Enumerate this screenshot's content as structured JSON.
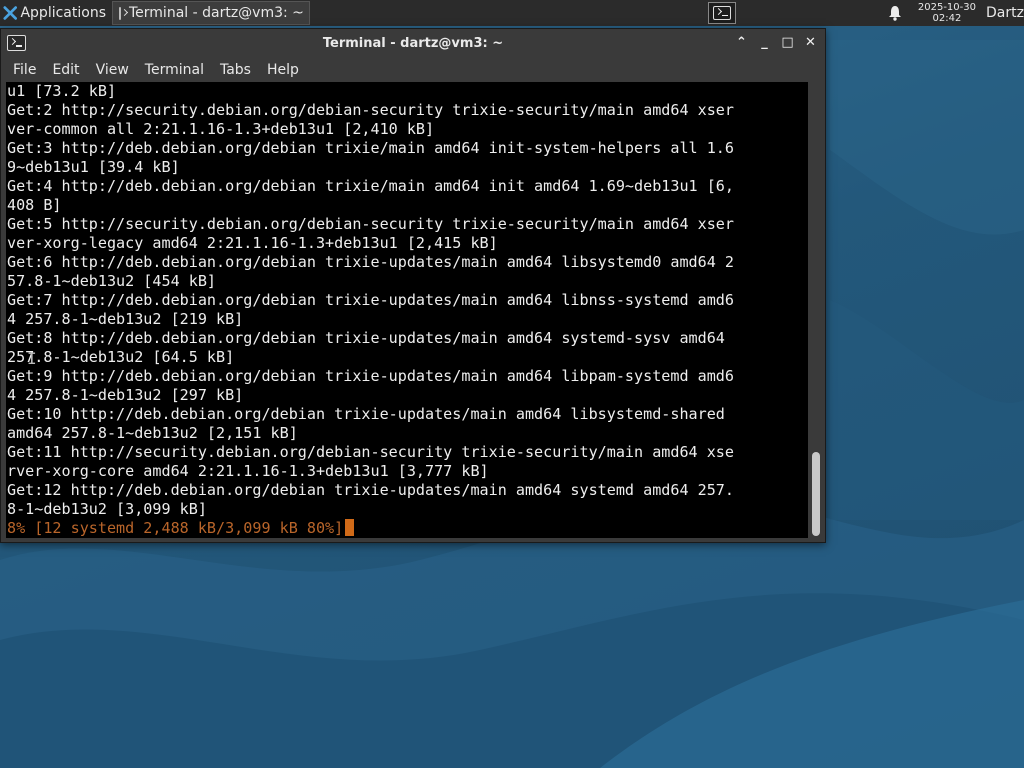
{
  "panel": {
    "apps_label": "Applications",
    "task_label": "Terminal - dartz@vm3: ~",
    "clock_date": "2025-10-30",
    "clock_time": "02:42",
    "user": "Dartz",
    "icons": {
      "apps": "xfce-logo-icon",
      "task": "terminal-icon",
      "workspace": "terminal-icon",
      "notifications": "bell-icon"
    }
  },
  "window": {
    "title": "Terminal - dartz@vm3: ~",
    "controls": [
      "shade",
      "minimize",
      "maximize",
      "close"
    ],
    "control_glyphs": {
      "shade": "⌃",
      "minimize": "_",
      "maximize": "□",
      "close": "✕"
    }
  },
  "menu": [
    "File",
    "Edit",
    "View",
    "Terminal",
    "Tabs",
    "Help"
  ],
  "terminal": {
    "lines": [
      "u1 [73.2 kB]",
      "Get:2 http://security.debian.org/debian-security trixie-security/main amd64 xser",
      "ver-common all 2:21.1.16-1.3+deb13u1 [2,410 kB]",
      "Get:3 http://deb.debian.org/debian trixie/main amd64 init-system-helpers all 1.6",
      "9~deb13u1 [39.4 kB]",
      "Get:4 http://deb.debian.org/debian trixie/main amd64 init amd64 1.69~deb13u1 [6,",
      "408 B]",
      "Get:5 http://security.debian.org/debian-security trixie-security/main amd64 xser",
      "ver-xorg-legacy amd64 2:21.1.16-1.3+deb13u1 [2,415 kB]",
      "Get:6 http://deb.debian.org/debian trixie-updates/main amd64 libsystemd0 amd64 2",
      "57.8-1~deb13u2 [454 kB]",
      "Get:7 http://deb.debian.org/debian trixie-updates/main amd64 libnss-systemd amd6",
      "4 257.8-1~deb13u2 [219 kB]",
      "Get:8 http://deb.debian.org/debian trixie-updates/main amd64 systemd-sysv amd64",
      "257.8-1~deb13u2 [64.5 kB]",
      "Get:9 http://deb.debian.org/debian trixie-updates/main amd64 libpam-systemd amd6",
      "4 257.8-1~deb13u2 [297 kB]",
      "Get:10 http://deb.debian.org/debian trixie-updates/main amd64 libsystemd-shared",
      "amd64 257.8-1~deb13u2 [2,151 kB]",
      "Get:11 http://security.debian.org/debian-security trixie-security/main amd64 xse",
      "rver-xorg-core amd64 2:21.1.16-1.3+deb13u1 [3,777 kB]",
      "Get:12 http://deb.debian.org/debian trixie-updates/main amd64 systemd amd64 257.",
      "8-1~deb13u2 [3,099 kB]"
    ],
    "progress_line": "8% [12 systemd 2,488 kB/3,099 kB 80%]",
    "colors": {
      "background": "#000000",
      "foreground": "#eeeeee",
      "progress": "#b9652a",
      "cursor": "#d06a18"
    }
  }
}
